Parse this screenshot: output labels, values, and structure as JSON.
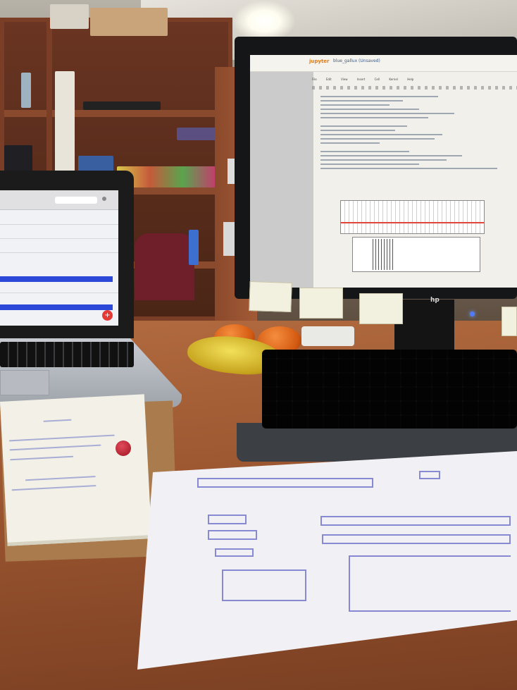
{
  "scene": {
    "description_free": true
  },
  "monitor": {
    "brand_logo": "hp",
    "notebook": {
      "app_logo": "jupyter",
      "notebook_title": "blue_gallux (Unsaved)",
      "menu_items": [
        "File",
        "Edit",
        "View",
        "Insert",
        "Cell",
        "Kernel",
        "Help"
      ],
      "plot_line_color": "#e0453a"
    },
    "sticky_notes": [
      "",
      "",
      ""
    ],
    "power_led_color": "#4f7bff"
  },
  "laptop": {
    "browser_url": "",
    "accent_color": "#2b48d8",
    "fab_icon": "plus-icon",
    "fab_color": "#e53935"
  },
  "desk_items": {
    "fruit": [
      "banana",
      "orange",
      "orange"
    ],
    "keyboard_color": "#2a2c30"
  }
}
